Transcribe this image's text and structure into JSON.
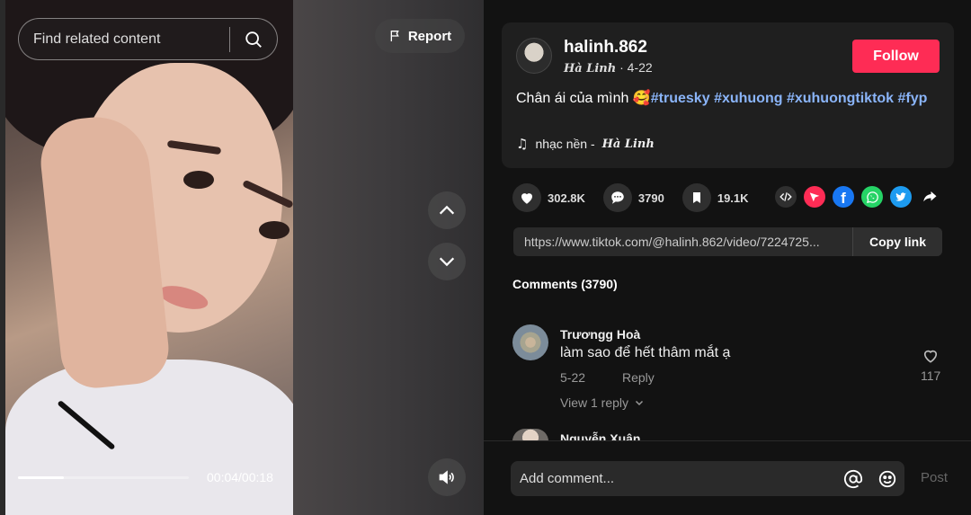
{
  "search": {
    "placeholder": "Find related content",
    "icon": "search-icon"
  },
  "video": {
    "report_label": "Report",
    "time": "00:04/00:18",
    "progress_fraction": 0.27
  },
  "author": {
    "username": "halinh.862",
    "nickname": "𝑯𝒂̀ 𝑳𝒊𝒏𝒉",
    "date": "4-22",
    "follow_label": "Follow"
  },
  "caption": {
    "text": "Chân ái của mình",
    "emoji": "🥰",
    "hashtags": [
      "#truesky",
      "#xuhuong",
      "#xuhuongtiktok",
      "#fyp"
    ]
  },
  "music": {
    "prefix": "nhạc nền -",
    "artist": "𝑯𝒂̀ 𝑳𝒊𝒏𝒉"
  },
  "actions": {
    "likes": "302.8K",
    "comments": "3790",
    "saves": "19.1K"
  },
  "share": {
    "link": "https://www.tiktok.com/@halinh.862/video/7224725...",
    "copy_label": "Copy link",
    "colors": {
      "tiktok": "#fe2c55",
      "facebook": "#1877f2",
      "whatsapp": "#25d366",
      "twitter": "#1d9bf0"
    }
  },
  "comments": {
    "title": "Comments (3790)",
    "items": [
      {
        "user": "Trươngg Hoà",
        "text": "làm sao để hết thâm mắt ạ",
        "date": "5-22",
        "reply_label": "Reply",
        "view_replies": "View 1 reply",
        "likes": "117"
      },
      {
        "user": "Nguyễn Xuân"
      }
    ]
  },
  "composer": {
    "placeholder": "Add comment...",
    "post_label": "Post"
  }
}
